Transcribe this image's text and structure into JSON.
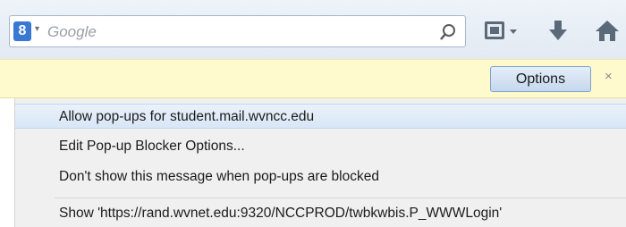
{
  "toolbar": {
    "engine_letter": "8",
    "engine_caret": "▾",
    "search_placeholder": "Google",
    "icons": [
      "search-engine-icon",
      "magnifier-icon",
      "bookmarks-icon",
      "download-icon",
      "home-icon"
    ]
  },
  "notification": {
    "options_label": "Options",
    "close_label": "×"
  },
  "menu": {
    "items": [
      {
        "label": "Allow pop-ups for student.mail.wvncc.edu"
      },
      {
        "label": "Edit Pop-up Blocker Options..."
      },
      {
        "label": "Don't show this message when pop-ups are blocked"
      },
      {
        "label": "Show 'https://rand.wvnet.edu:9320/NCCPROD/twbkwbis.P_WWWLogin'"
      }
    ]
  },
  "colors": {
    "notification_bg": "#fffacd",
    "hover_bg": "#dce9f7",
    "button_border": "#7da2cf"
  }
}
